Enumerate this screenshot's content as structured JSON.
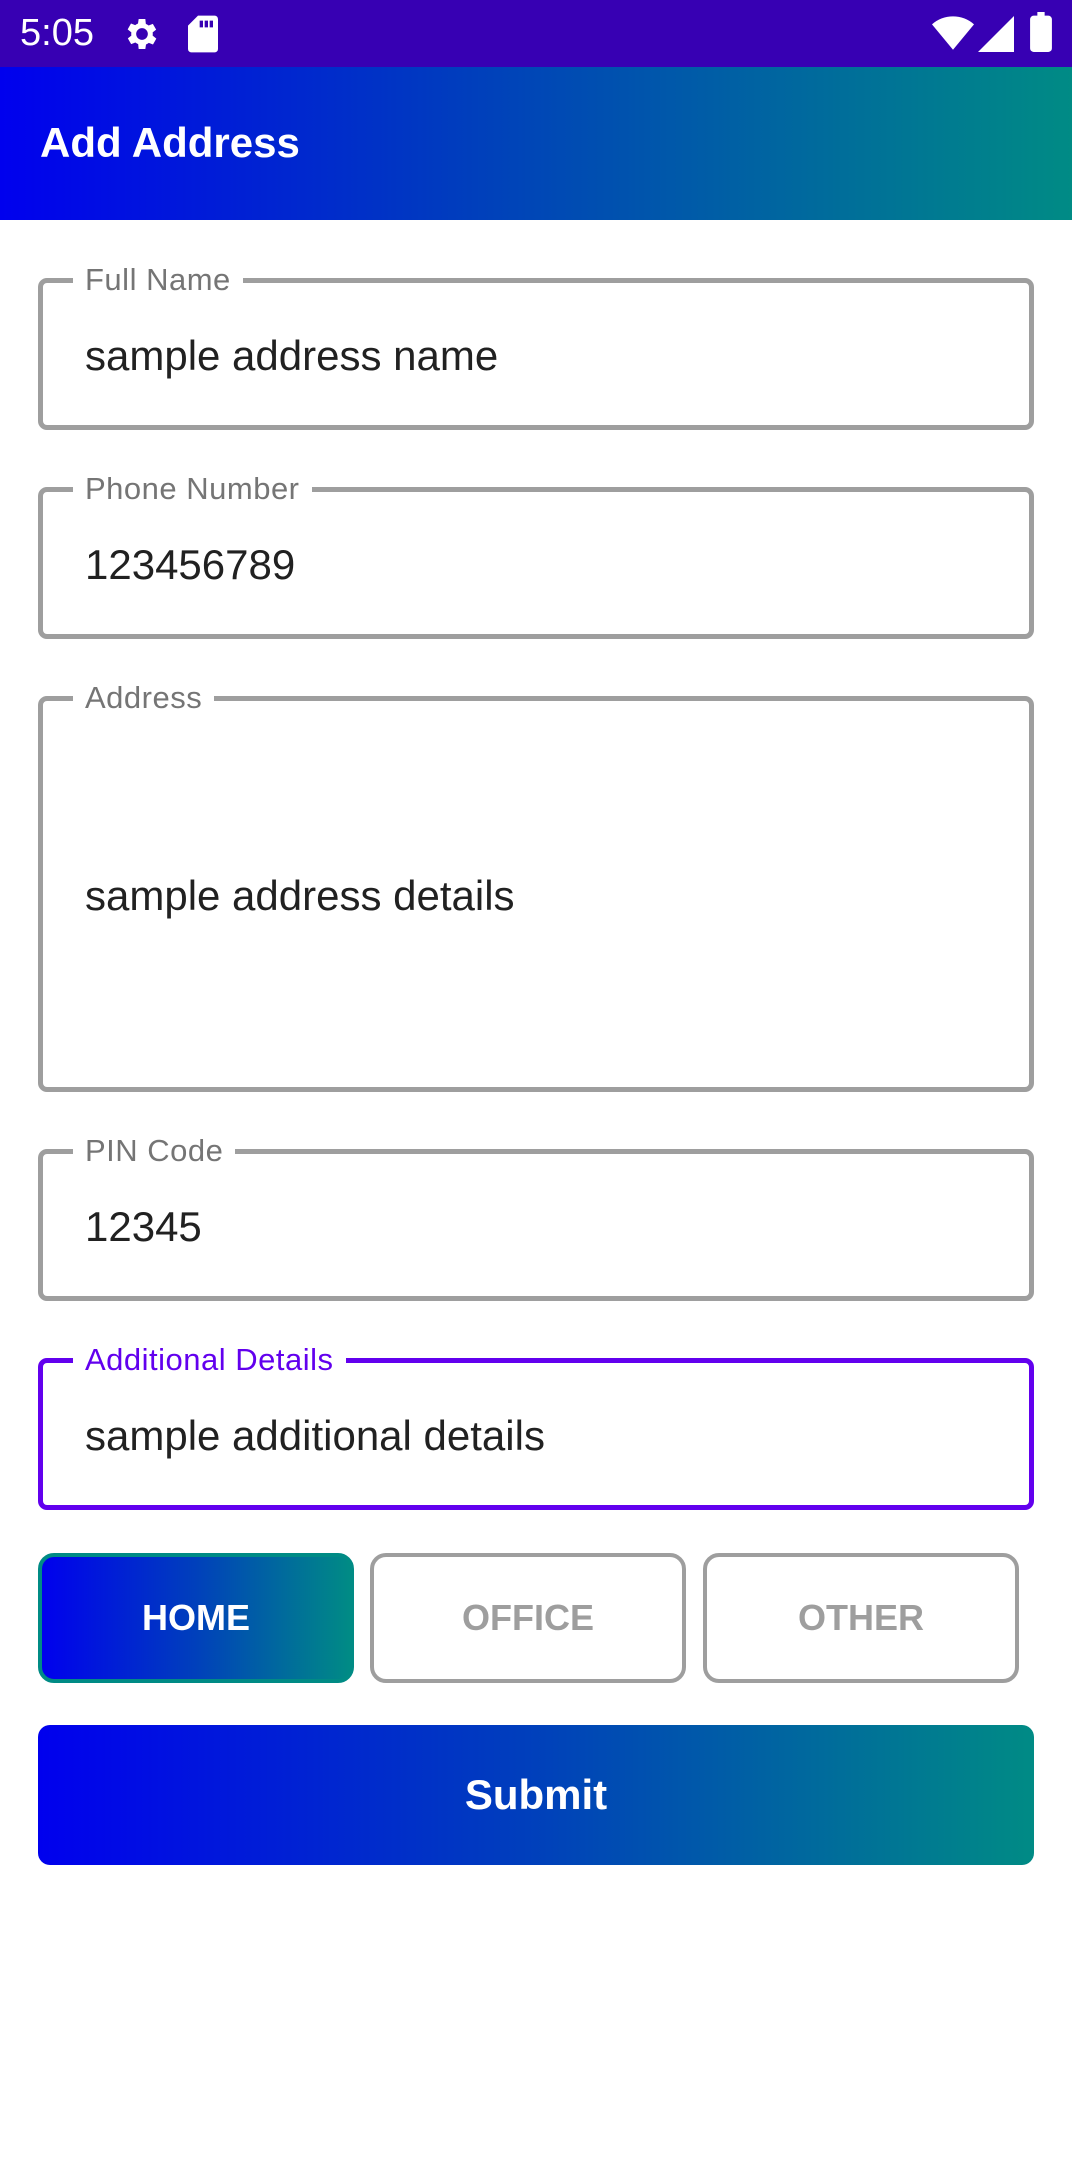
{
  "status_bar": {
    "time": "5:05",
    "icons": [
      "gear-icon",
      "sd-card-icon",
      "wifi-icon",
      "cellular-signal-icon",
      "battery-icon"
    ]
  },
  "app_bar": {
    "title": "Add Address"
  },
  "form": {
    "full_name": {
      "label": "Full Name",
      "value": "sample address name"
    },
    "phone_number": {
      "label": "Phone Number",
      "value": "123456789"
    },
    "address": {
      "label": "Address",
      "value": "sample address details"
    },
    "pin_code": {
      "label": "PIN Code",
      "value": "12345"
    },
    "additional_details": {
      "label": "Additional Details",
      "value": "sample additional details"
    }
  },
  "address_type": {
    "options": [
      "HOME",
      "OFFICE",
      "OTHER"
    ],
    "selected": "HOME"
  },
  "submit_label": "Submit",
  "colors": {
    "status_bar": "#3700b3",
    "accent": "#6200ee",
    "gradient_start": "#0000ee",
    "gradient_end": "#008b85",
    "outline": "#9e9e9e"
  }
}
